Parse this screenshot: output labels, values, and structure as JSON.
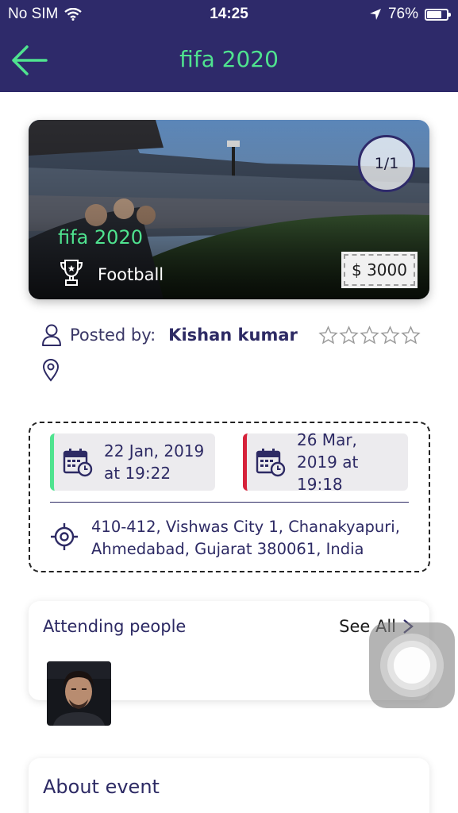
{
  "status_bar": {
    "carrier": "No SIM",
    "time": "14:25",
    "battery": "76%"
  },
  "nav": {
    "title": "fifa 2020"
  },
  "hero": {
    "title": "fifa 2020",
    "category": "Football",
    "page_indicator": "1/1",
    "price": "$ 3000"
  },
  "posted_by": {
    "label": "Posted by:",
    "name": "Kishan kumar",
    "rating": 0,
    "max_rating": 5
  },
  "dates": {
    "start_line1": "22 Jan, 2019",
    "start_line2": "at 19:22",
    "end_line1": "26 Mar,",
    "end_line2": "2019 at 19:18"
  },
  "location": {
    "line1": "410-412, Vishwas City 1, Chanakyapuri,",
    "line2": "Ahmedabad, Gujarat 380061, India"
  },
  "attending": {
    "title": "Attending people",
    "see_all": "See All"
  },
  "about": {
    "title": "About event"
  },
  "colors": {
    "primary": "#2e2a6a",
    "accent_green": "#4fe38f",
    "accent_red": "#d6223a"
  }
}
